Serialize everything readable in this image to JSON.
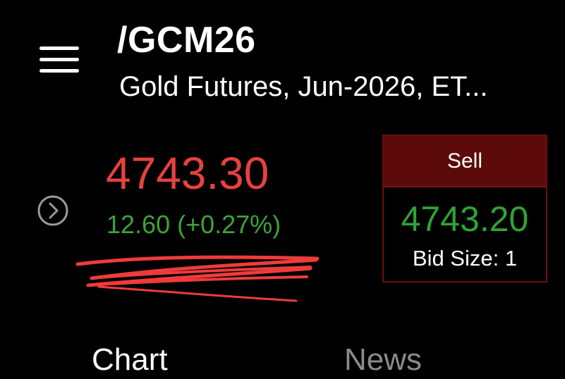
{
  "header": {
    "symbol": "/GCM26",
    "contract_name": "Gold Futures, Jun-2026, ET...",
    "menu_icon": "hamburger-menu-icon"
  },
  "quote": {
    "last_price": "4743.30",
    "change": "12.60 (+0.27%)",
    "expand_icon": "chevron-right-circle-icon"
  },
  "sell": {
    "label": "Sell",
    "bid_price": "4743.20",
    "bid_size": "Bid Size: 1"
  },
  "tabs": [
    {
      "label": "Chart",
      "active": true
    },
    {
      "label": "News",
      "active": false
    }
  ],
  "colors": {
    "background": "#000000",
    "price_down_red": "#e8413f",
    "change_up_green": "#3ca33a",
    "sell_header_bg": "#5c0a0a",
    "sell_border": "#6b0f0f",
    "bid_price_green": "#2fa336",
    "tab_active": "#ffffff",
    "tab_inactive": "#8a8a8a",
    "scribble_red": "#ee3b3b"
  }
}
